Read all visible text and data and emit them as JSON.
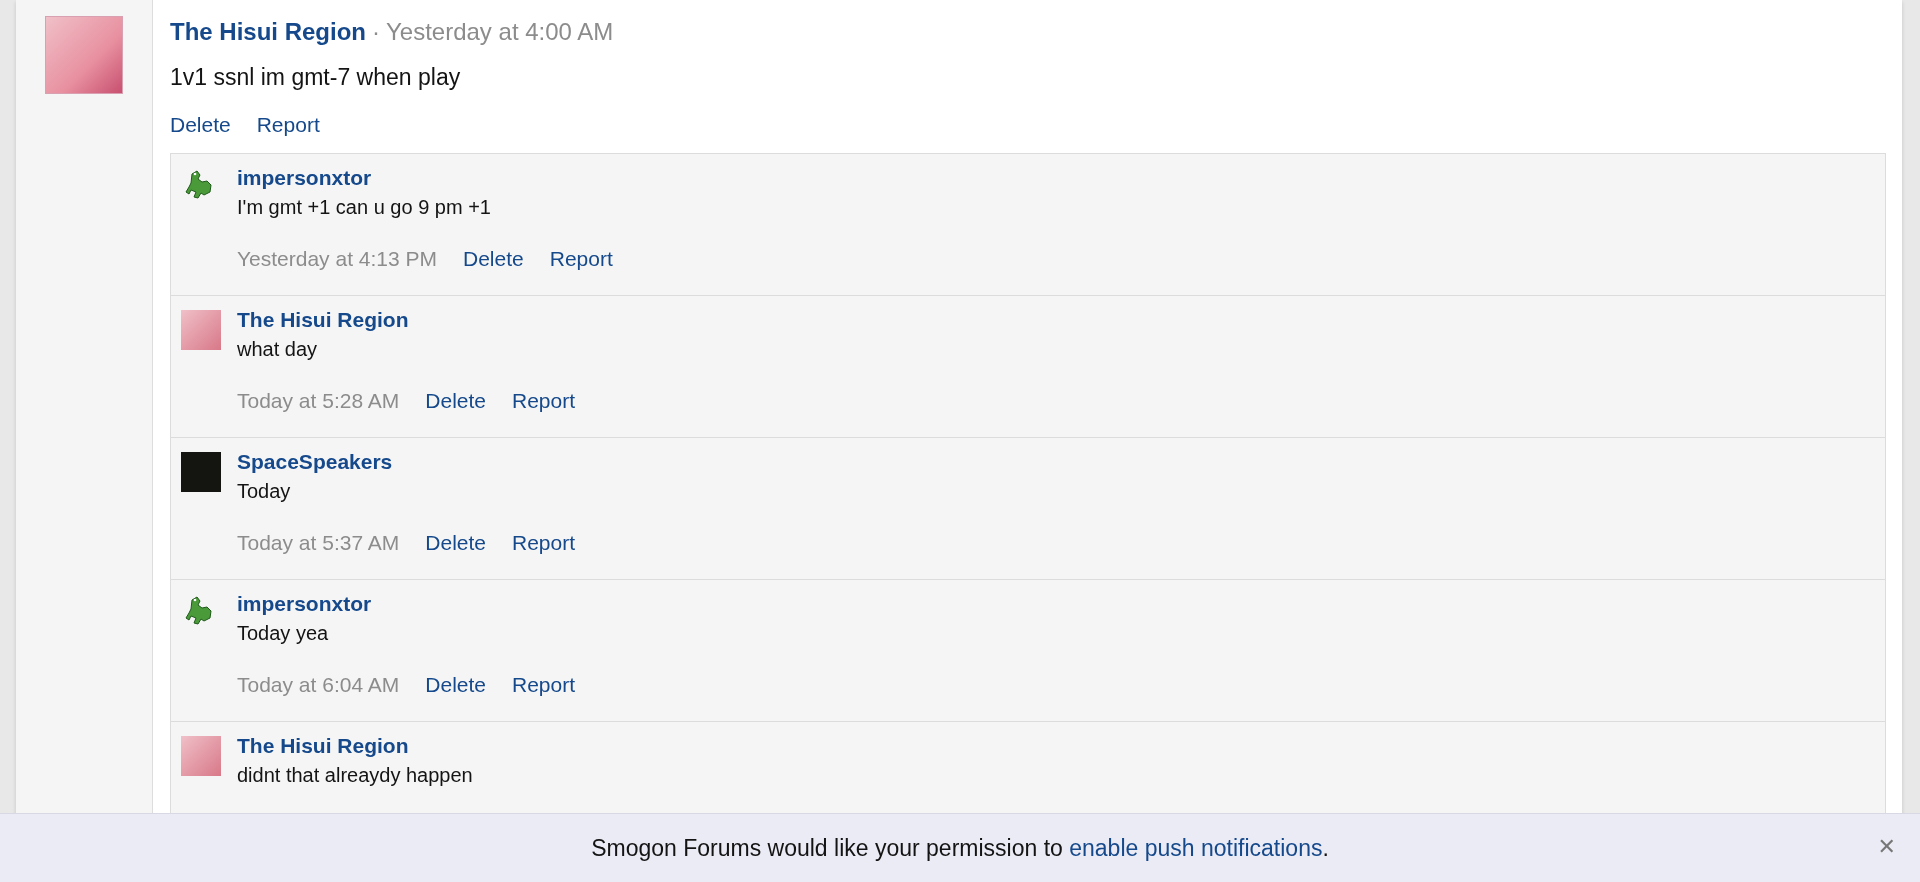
{
  "post": {
    "author": "The Hisui Region",
    "separator": "·",
    "time": "Yesterday at 4:00 AM",
    "message": "1v1 ssnl im gmt-7 when play",
    "actions": [
      "Delete",
      "Report"
    ]
  },
  "comments": [
    {
      "author": "impersonxtor",
      "kind": "sprite",
      "message": "I'm gmt +1 can u go 9 pm +1",
      "time": "Yesterday at 4:13 PM",
      "actions": [
        "Delete",
        "Report"
      ]
    },
    {
      "author": "The Hisui Region",
      "kind": "photo",
      "message": "what day",
      "time": "Today at 5:28 AM",
      "actions": [
        "Delete",
        "Report"
      ]
    },
    {
      "author": "SpaceSpeakers",
      "kind": "dark",
      "message": "Today",
      "time": "Today at 5:37 AM",
      "actions": [
        "Delete",
        "Report"
      ]
    },
    {
      "author": "impersonxtor",
      "kind": "sprite",
      "message": "Today yea",
      "time": "Today at 6:04 AM",
      "actions": [
        "Delete",
        "Report"
      ]
    },
    {
      "author": "The Hisui Region",
      "kind": "photo",
      "message": "didnt that alreaydy happen"
    }
  ],
  "notice": {
    "text": "Smogon Forums would like your permission to",
    "link": "enable push notifications",
    "end": ".",
    "close": "✕"
  }
}
